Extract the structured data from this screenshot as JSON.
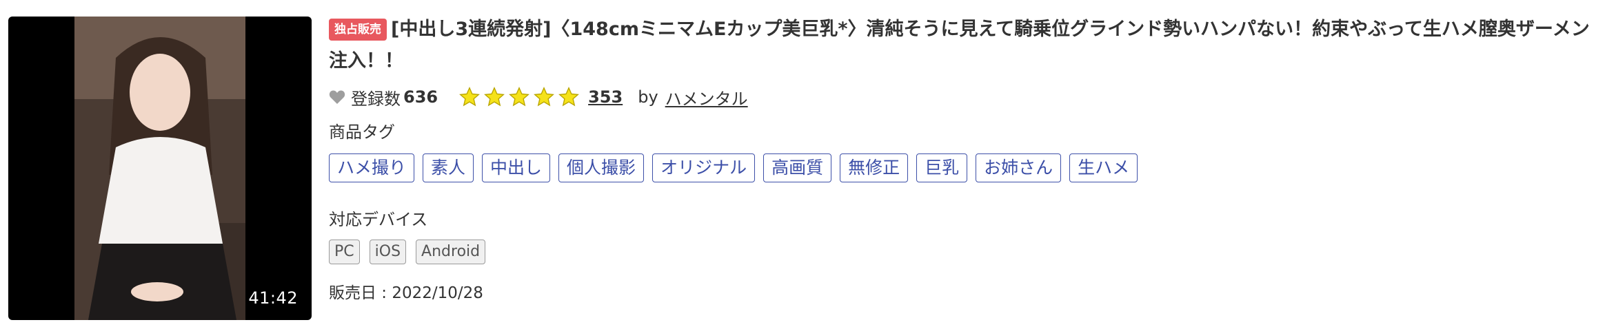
{
  "video": {
    "duration": "41:42"
  },
  "product": {
    "badge": "独占販売",
    "title": "[中出し3連続発射]〈148cmミニマムEカップ美巨乳*〉清純そうに見えて騎乗位グラインド勢いハンパない！約束やぶって生ハメ膣奥ザーメン注入！！",
    "favorites_label": "登録数",
    "favorites_count": "636",
    "rating_stars": 5,
    "review_count": "353",
    "by_label": "by",
    "author": "ハメンタル"
  },
  "tags": {
    "label": "商品タグ",
    "items": [
      "ハメ撮り",
      "素人",
      "中出し",
      "個人撮影",
      "オリジナル",
      "高画質",
      "無修正",
      "巨乳",
      "お姉さん",
      "生ハメ"
    ]
  },
  "devices": {
    "label": "対応デバイス",
    "items": [
      "PC",
      "iOS",
      "Android"
    ]
  },
  "release": {
    "text": "販売日 : 2022/10/28"
  },
  "icons": {
    "favorite": "heart-icon",
    "rating": "star-icon"
  },
  "colors": {
    "badge": "#e8585e",
    "tag": "#3c4fa8",
    "star": "#f5e21a",
    "heart": "#9e9e9e"
  }
}
